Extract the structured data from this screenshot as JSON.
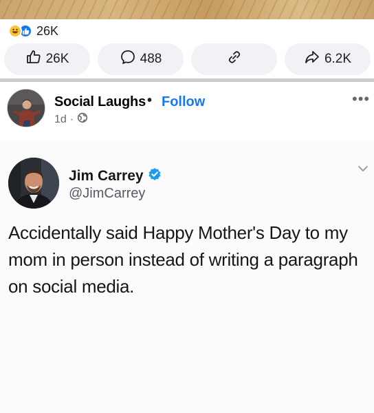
{
  "reactions_summary": {
    "count": "26K",
    "icons": [
      "haha-reaction-icon",
      "like-reaction-icon"
    ]
  },
  "actions": {
    "like": {
      "count": "26K",
      "icon": "thumbs-up-icon"
    },
    "comment": {
      "count": "488",
      "icon": "comment-bubble-icon"
    },
    "copy_link": {
      "icon": "link-icon"
    },
    "share": {
      "count": "6.2K",
      "icon": "share-arrow-icon"
    }
  },
  "post": {
    "page_name": "Social Laughs",
    "separator_dot": "•",
    "follow_label": "Follow",
    "time": "1d",
    "meta_dot": "·",
    "audience_icon": "globe-icon",
    "more_icon": "more-options-icon",
    "more_label": "•••"
  },
  "tweet": {
    "name": "Jim Carrey",
    "handle": "@JimCarrey",
    "verified_icon": "verified-badge-icon",
    "text": "Accidentally said Happy Mother's Day to my mom in person instead of writing a paragraph on social media."
  },
  "colors": {
    "accent": "#1877f2",
    "button_bg": "#f0f2f5",
    "muted": "#65676b",
    "verified": "#1d9bf0"
  }
}
